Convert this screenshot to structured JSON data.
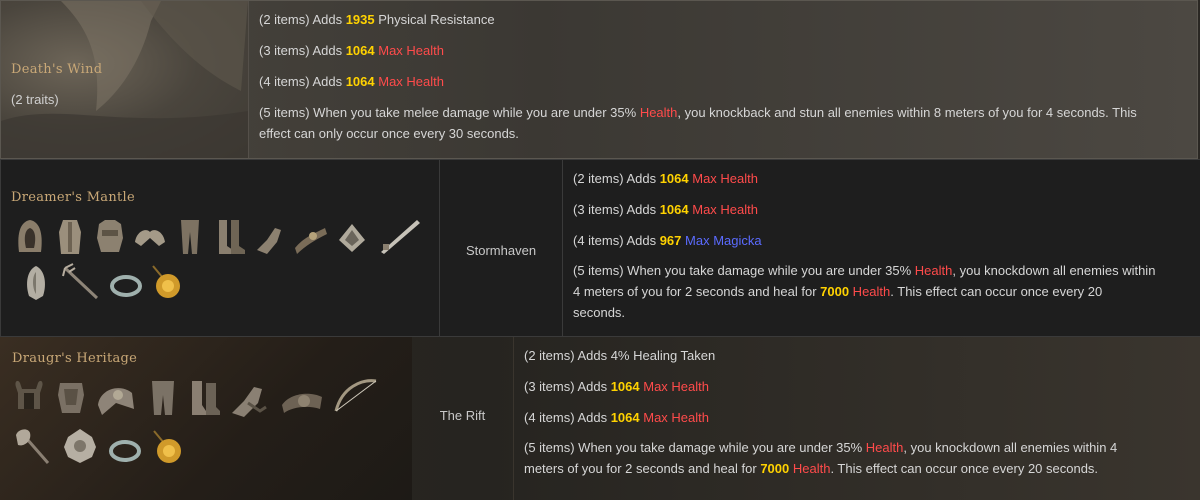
{
  "sets": [
    {
      "name": "Death's Wind",
      "traits": "(2 traits)",
      "bonuses": [
        {
          "pre": "(2 items) Adds ",
          "num": "1935",
          "stat": " Physical Resistance",
          "stat_color": "plain"
        },
        {
          "pre": "(3 items) Adds ",
          "num": "1064",
          "stat": " Max Health",
          "stat_color": "red"
        },
        {
          "pre": "(4 items) Adds ",
          "num": "1064",
          "stat": " Max Health",
          "stat_color": "red"
        }
      ],
      "five": {
        "a": "(5 items) When you take melee damage while you are under 35% ",
        "b": "Health",
        "c": ", you knockback and stun all enemies within 8 meters of you for 4 seconds. This",
        "d": "effect can only occur once every 30 seconds."
      }
    },
    {
      "name": "Dreamer's Mantle",
      "zone": "Stormhaven",
      "bonuses": [
        {
          "pre": "(2 items) Adds ",
          "num": "1064",
          "stat": " Max Health"
        },
        {
          "pre": "(3 items) Adds ",
          "num": "1064",
          "stat": " Max Health"
        },
        {
          "pre": "(4 items) Adds ",
          "num": "967",
          "stat": " Max Magicka"
        }
      ],
      "five": {
        "l1a": "(5 items) When you take damage while you are under 35% ",
        "l1b": "Health",
        "l1c": ", you knockdown all enemies within",
        "l2a": "4 meters of you for 2 seconds and heal for ",
        "l2b": "7000",
        "l2c": " Health",
        "l2d": ". This effect can occur once every 20",
        "l3": "seconds."
      }
    },
    {
      "name": "Draugr's Heritage",
      "zone": "The Rift",
      "bonuses": [
        {
          "pre": "(2 items) Adds 4% Healing Taken"
        },
        {
          "pre": "(3 items) Adds ",
          "num": "1064",
          "stat": " Max Health"
        },
        {
          "pre": "(4 items) Adds ",
          "num": "1064",
          "stat": " Max Health"
        }
      ],
      "five": {
        "l1a": "(5 items) When you take damage while you are under 35% ",
        "l1b": "Health",
        "l1c": ", you knockdown all enemies within 4",
        "l2a": "meters of you for 2 seconds and heal for ",
        "l2b": "7000",
        "l2c": " Health",
        "l2d": ". This effect can occur once every 20 seconds."
      }
    }
  ],
  "icons": {
    "dreamers": [
      "hood-icon",
      "robe-icon",
      "jerkin-icon",
      "shoulders-icon",
      "breeches-icon",
      "boots-icon",
      "gloves-icon",
      "belt-icon",
      "sword-icon",
      "shield-icon",
      "staff-icon",
      "ring-icon",
      "amulet-icon"
    ],
    "draugr": [
      "helm-icon",
      "cuirass-icon",
      "pauldron-icon",
      "greaves-icon",
      "boots-icon",
      "gauntlets-icon",
      "girdle-icon",
      "bow-icon",
      "axe-icon",
      "shield-icon",
      "ring-icon",
      "amulet-icon"
    ]
  },
  "colors": {
    "number": "#ffd200",
    "health": "#ff4b4b",
    "magicka": "#5b6bff",
    "set_name": "#c9a877"
  }
}
